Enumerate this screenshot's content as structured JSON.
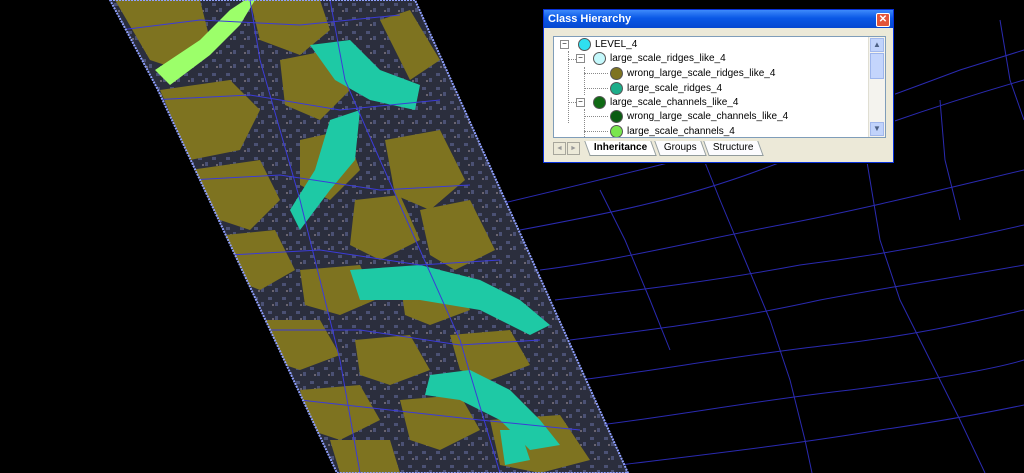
{
  "window": {
    "title": "Class Hierarchy",
    "close_symbol": "✕"
  },
  "tree": {
    "nodes": [
      {
        "label": "LEVEL_4",
        "color": "#2fe0f0",
        "expander": "−"
      },
      {
        "label": "large_scale_ridges_like_4",
        "color": "#c4f8fb",
        "expander": "−"
      },
      {
        "label": "wrong_large_scale_ridges_like_4",
        "color": "#7e7320"
      },
      {
        "label": "large_scale_ridges_4",
        "color": "#1dae8a"
      },
      {
        "label": "large_scale_channels_like_4",
        "color": "#0f6a14",
        "expander": "−"
      },
      {
        "label": "wrong_large_scale_channels_like_4",
        "color": "#0a5c12"
      },
      {
        "label": "large_scale_channels_4",
        "color": "#7ae64e"
      }
    ]
  },
  "scroll": {
    "up": "▲",
    "down": "▼"
  },
  "tabs": {
    "nav_left": "◄",
    "nav_right": "►",
    "items": [
      {
        "label": "Inheritance",
        "active": true
      },
      {
        "label": "Groups",
        "active": false
      },
      {
        "label": "Structure",
        "active": false
      }
    ]
  },
  "colors": {
    "background": "#000000",
    "segment_outline": "#3b3bd8",
    "olive": "#7e7320",
    "teal": "#1ec9a5",
    "dark_gray": "#2b2e3d",
    "slate": "#4b5174",
    "bright_green": "#9cff6a"
  },
  "icons": [
    "close-icon",
    "scroll-up-icon",
    "scroll-down-icon",
    "nav-left-icon",
    "nav-right-icon"
  ]
}
